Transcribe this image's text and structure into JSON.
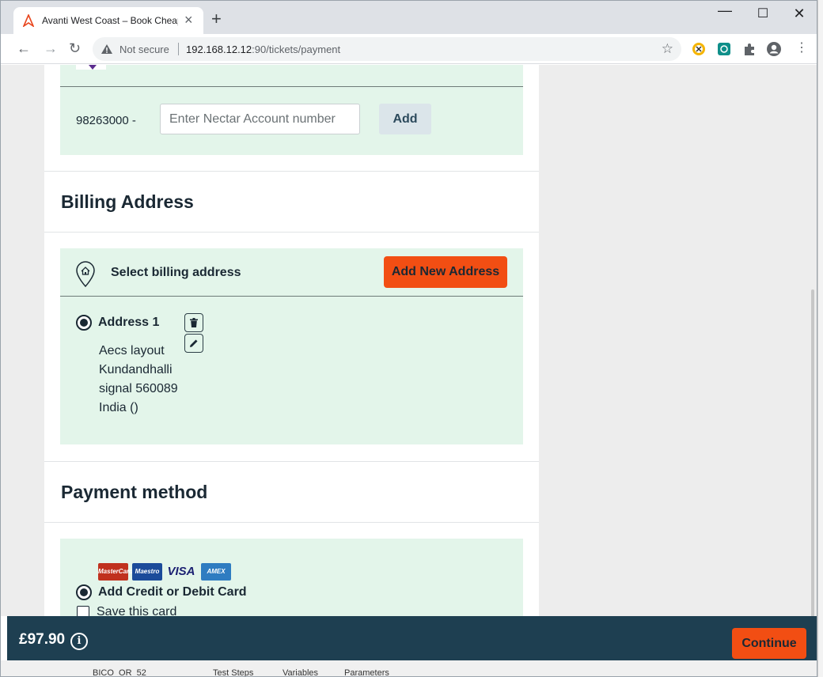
{
  "browser": {
    "tab_title": "Avanti West Coast – Book Cheap",
    "security_label": "Not secure",
    "url_host": "192.168.12.12",
    "url_path": ":90/tickets/payment"
  },
  "nectar": {
    "prefix": "98263000 -",
    "input_placeholder": "Enter Nectar Account number",
    "add_label": "Add"
  },
  "billing": {
    "title": "Billing Address",
    "select_label": "Select billing address",
    "add_new_label": "Add New Address",
    "address": {
      "name": "Address 1",
      "lines": [
        "Aecs layout",
        "Kundandhalli",
        "signal 560089",
        "India ()"
      ]
    }
  },
  "payment": {
    "title": "Payment method",
    "cards": [
      "MasterCard",
      "Maestro",
      "VISA",
      "AMEX"
    ],
    "option_label": "Add Credit or Debit Card",
    "save_label": "Save this card"
  },
  "footer": {
    "price": "£97.90",
    "continue_label": "Continue"
  },
  "colors": {
    "accent": "#f24e13",
    "panel_green": "#e3f5ea",
    "footer_bg": "#1e3f51"
  },
  "taskbar": {
    "items": [
      "BICO_OR_52",
      "Test Steps",
      "Variables",
      "Parameters"
    ]
  }
}
